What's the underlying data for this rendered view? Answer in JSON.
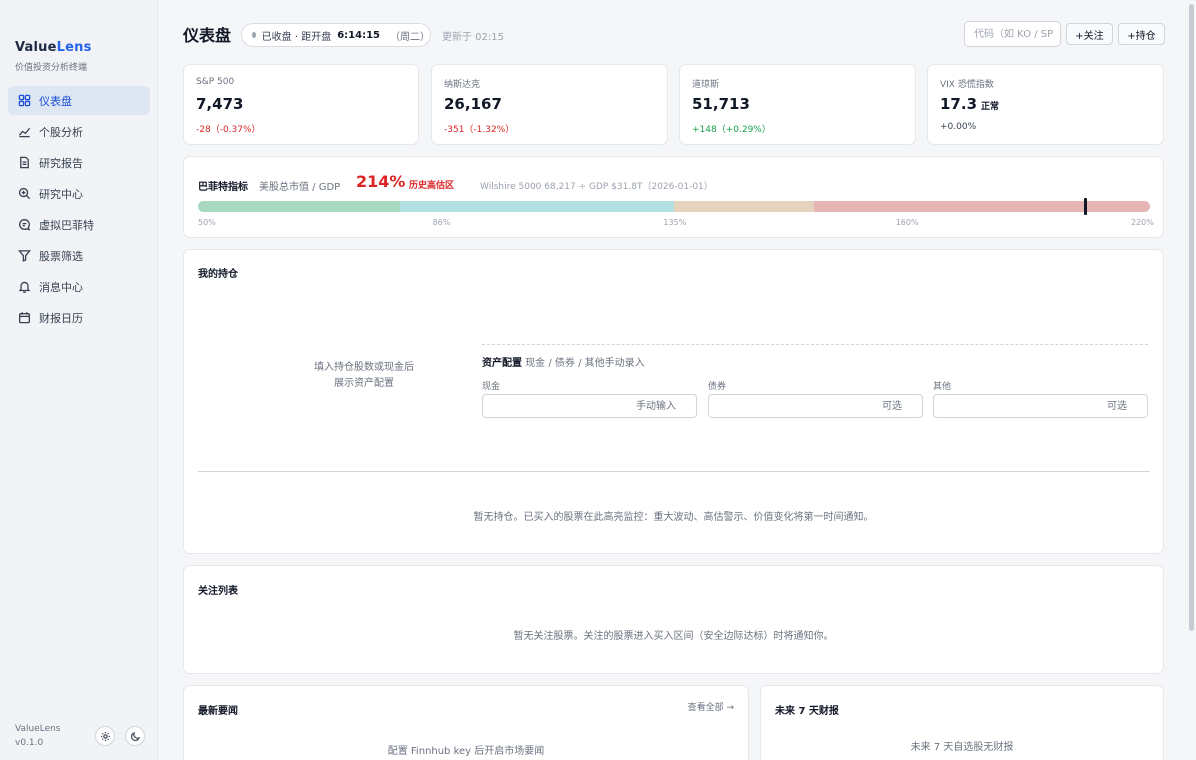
{
  "app": {
    "name_prefix": "Value",
    "name_accent": "Lens",
    "subtitle": "价值投资分析终端",
    "footer_name": "ValueLens",
    "version": "v0.1.0"
  },
  "sidebar": {
    "items": [
      {
        "label": "仪表盘",
        "icon": "dashboard-icon",
        "active": true
      },
      {
        "label": "个股分析",
        "icon": "chart-trend-icon"
      },
      {
        "label": "研究报告",
        "icon": "document-icon"
      },
      {
        "label": "研究中心",
        "icon": "search-zoom-icon"
      },
      {
        "label": "虚拟巴菲特",
        "icon": "chat-icon"
      },
      {
        "label": "股票筛选",
        "icon": "filter-icon"
      },
      {
        "label": "消息中心",
        "icon": "bell-icon"
      },
      {
        "label": "财报日历",
        "icon": "calendar-icon"
      }
    ]
  },
  "header": {
    "title": "仪表盘",
    "market_status": "已收盘 · 距开盘",
    "countdown": "6:14:15",
    "weekday": "（周二）",
    "updated": "更新于 02:15",
    "search_placeholder": "代码（如 KO / SP",
    "follow_button": "+关注",
    "hold_button": "+持仓"
  },
  "indices": [
    {
      "name": "S&P 500",
      "value": "7,473",
      "extra": "",
      "change": "-28（-0.37%）",
      "tone": "neg"
    },
    {
      "name": "纳斯达克",
      "value": "26,167",
      "extra": "",
      "change": "-351（-1.32%）",
      "tone": "neg"
    },
    {
      "name": "道琼斯",
      "value": "51,713",
      "extra": "",
      "change": "+148（+0.29%）",
      "tone": "pos"
    },
    {
      "name": "VIX 恐慌指数",
      "value": "17.3",
      "extra": "正常",
      "change": "+0.00%",
      "tone": "neutral"
    }
  ],
  "buffett": {
    "label": "巴菲特指标",
    "desc": "美股总市值 / GDP",
    "value": "214%",
    "value_num": 214,
    "tag": "历史高估区",
    "note": "Wilshire 5000 68,217 ÷ GDP $31.8T（2026-01-01）",
    "scale_min": 50,
    "scale_max": 220,
    "ticks": [
      "50%",
      "86%",
      "135%",
      "160%",
      "220%"
    ],
    "segments": [
      {
        "to": 86,
        "color": "#a8d8bf"
      },
      {
        "to": 135,
        "color": "#b2e0e0"
      },
      {
        "to": 160,
        "color": "#e6d3bd"
      },
      {
        "to": 220,
        "color": "#e7b4b5"
      }
    ]
  },
  "holdings": {
    "title": "我的持仓",
    "empty_alloc_line1": "填入持仓股数或现金后",
    "empty_alloc_line2": "展示资产配置",
    "alloc_title": "资产配置",
    "alloc_hint": "现金 / 债券 / 其他手动录入",
    "fields": [
      {
        "label": "现金",
        "placeholder": "手动输入"
      },
      {
        "label": "债券",
        "placeholder": "可选"
      },
      {
        "label": "其他",
        "placeholder": "可选"
      }
    ],
    "empty_msg": "暂无持仓。已买入的股票在此高亮监控：重大波动、高估警示、价值变化将第一时间通知。"
  },
  "watchlist": {
    "title": "关注列表",
    "empty_msg": "暂无关注股票。关注的股票进入买入区间（安全边际达标）时将通知你。"
  },
  "news": {
    "title": "最新要闻",
    "view_all": "查看全部 →",
    "empty_msg": "配置 Finnhub key 后开启市场要闻"
  },
  "earnings": {
    "title": "未来 7 天财报",
    "empty_msg": "未来 7 天自选股无财报"
  }
}
